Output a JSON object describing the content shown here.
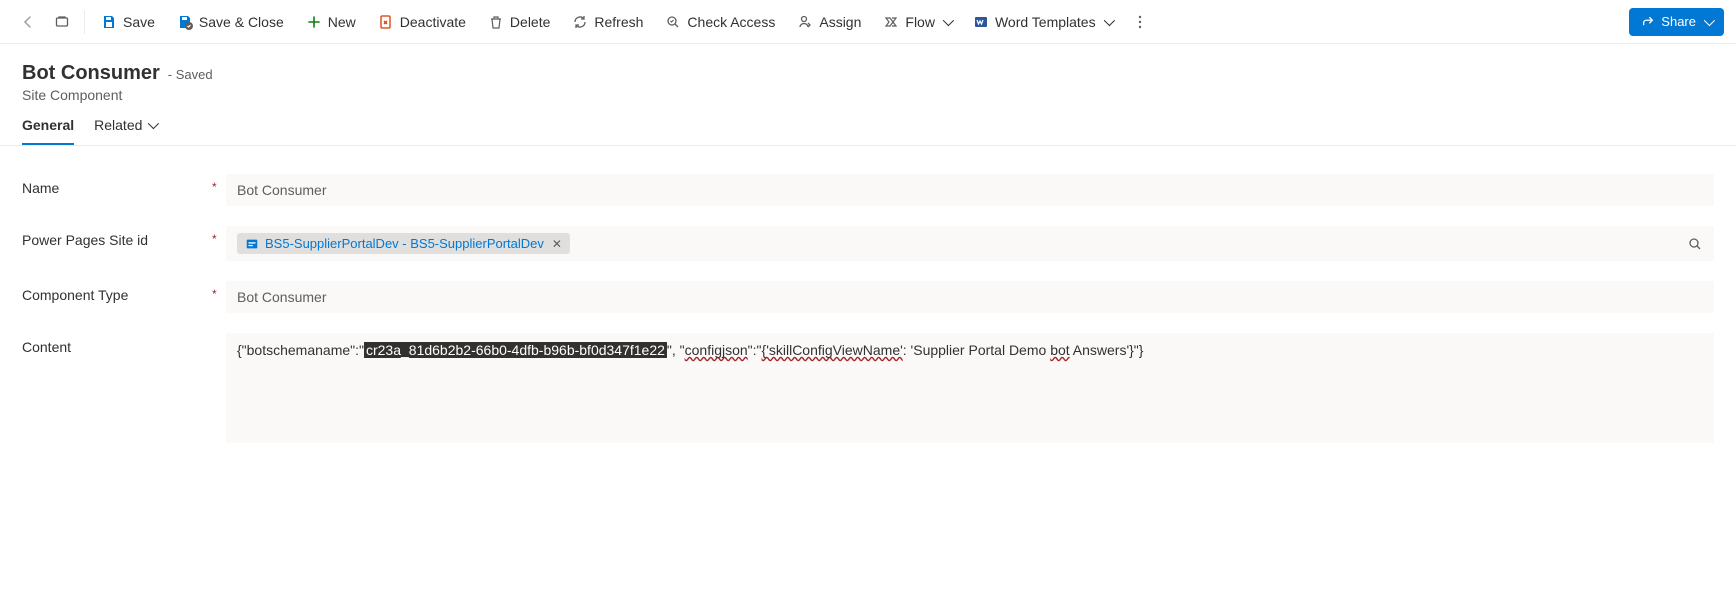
{
  "toolbar": {
    "save": "Save",
    "save_close": "Save & Close",
    "new": "New",
    "deactivate": "Deactivate",
    "delete": "Delete",
    "refresh": "Refresh",
    "check_access": "Check Access",
    "assign": "Assign",
    "flow": "Flow",
    "word_templates": "Word Templates",
    "share": "Share"
  },
  "header": {
    "title": "Bot Consumer",
    "status": "- Saved",
    "subtitle": "Site Component"
  },
  "tabs": {
    "general": "General",
    "related": "Related"
  },
  "form": {
    "name": {
      "label": "Name",
      "value": "Bot Consumer"
    },
    "site": {
      "label": "Power Pages Site id",
      "tag": "BS5-SupplierPortalDev - BS5-SupplierPortalDev"
    },
    "component_type": {
      "label": "Component Type",
      "value": "Bot Consumer"
    },
    "content": {
      "label": "Content",
      "prefix": "{\"botschemaname\":\"",
      "highlighted": "cr23a_81d6b2b2-66b0-4dfb-b96b-bf0d347f1e22",
      "mid1": "\", \"",
      "configjson": "configjson",
      "mid2": "\":\"",
      "skill_open": "{'skillConfigViewName'",
      "mid3": ": 'Supplier Portal Demo ",
      "bot": "bot",
      "suffix": " Answers'}\"}"
    }
  }
}
